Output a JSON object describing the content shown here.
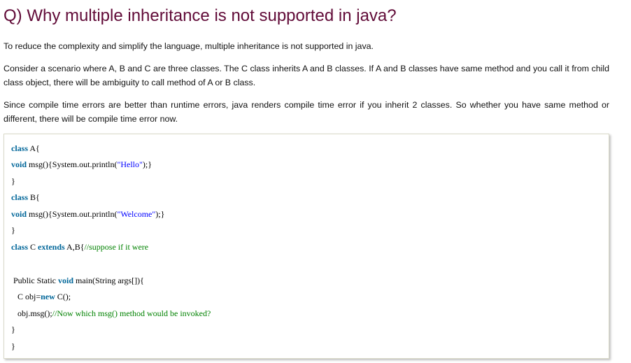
{
  "article": {
    "title": "Q) Why multiple inheritance is not supported in java?",
    "paragraphs": [
      "To reduce the complexity and simplify the language, multiple inheritance is not supported in java.",
      "Consider a scenario where A, B and C are three classes. The C class inherits A and B classes. If A and B classes have same method and you call it from child class object, there will be ambiguity to call method of A or B class.",
      "Since compile time errors are better than runtime errors, java renders compile time error if you inherit 2 classes. So whether you have same method or different, there will be compile time error now."
    ]
  },
  "code": {
    "lines": [
      [
        {
          "t": "class",
          "k": "kw"
        },
        {
          "t": " A{",
          "k": "plain"
        }
      ],
      [
        {
          "t": "void",
          "k": "kw"
        },
        {
          "t": " msg(){System.out.println(",
          "k": "plain"
        },
        {
          "t": "\"Hello\"",
          "k": "str"
        },
        {
          "t": ");}",
          "k": "plain"
        }
      ],
      [
        {
          "t": "}",
          "k": "plain"
        }
      ],
      [
        {
          "t": "class",
          "k": "kw"
        },
        {
          "t": " B{",
          "k": "plain"
        }
      ],
      [
        {
          "t": "void",
          "k": "kw"
        },
        {
          "t": " msg(){System.out.println(",
          "k": "plain"
        },
        {
          "t": "\"Welcome\"",
          "k": "str"
        },
        {
          "t": ");}",
          "k": "plain"
        }
      ],
      [
        {
          "t": "}",
          "k": "plain"
        }
      ],
      [
        {
          "t": "class",
          "k": "kw"
        },
        {
          "t": " C ",
          "k": "plain"
        },
        {
          "t": "extends",
          "k": "kw"
        },
        {
          "t": " A,B{",
          "k": "plain"
        },
        {
          "t": "//suppose if it were",
          "k": "cm"
        }
      ],
      [],
      [
        {
          "t": " Public Static ",
          "k": "plain"
        },
        {
          "t": "void",
          "k": "kw"
        },
        {
          "t": " main(String args[]){",
          "k": "plain"
        }
      ],
      [
        {
          "t": "   C obj=",
          "k": "plain"
        },
        {
          "t": "new",
          "k": "kw"
        },
        {
          "t": " C();",
          "k": "plain"
        }
      ],
      [
        {
          "t": "   obj.msg();",
          "k": "plain"
        },
        {
          "t": "//Now which msg() method would be invoked?",
          "k": "cm"
        }
      ],
      [
        {
          "t": "}",
          "k": "plain"
        }
      ],
      [
        {
          "t": "}",
          "k": "plain"
        }
      ]
    ]
  },
  "colors": {
    "title": "#610b38",
    "keyword": "#006699",
    "string": "#0000ff",
    "comment": "#008200"
  }
}
